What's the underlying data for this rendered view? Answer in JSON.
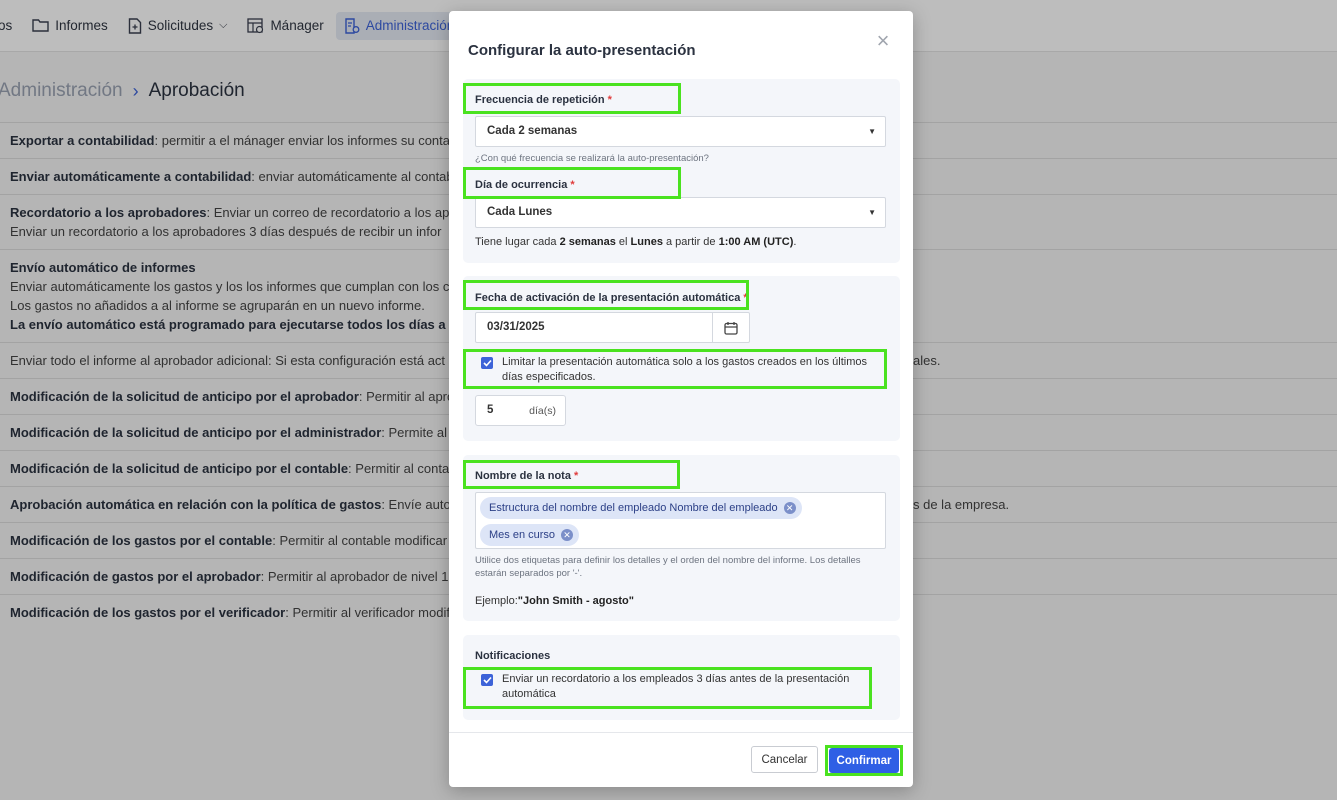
{
  "nav": {
    "items": [
      "os",
      "Informes",
      "Solicitudes",
      "Mánager",
      "Administración"
    ]
  },
  "breadcrumb": {
    "parent": "Administración",
    "current": "Aprobación"
  },
  "settings": [
    {
      "title": "Exportar a contabilidad",
      "lines": [
        ": permitir a el mánager enviar los informes su conta"
      ]
    },
    {
      "title": "Enviar automáticamente a contabilidad",
      "lines": [
        ": enviar automáticamente al contab"
      ]
    },
    {
      "title": "Recordatorio a los aprobadores",
      "lines": [
        ": Enviar un correo de recordatorio a los apr",
        "Enviar un recordatorio a los aprobadores 3 días después de recibir un infor"
      ]
    },
    {
      "title": "Envío automático de informes",
      "lines": [
        "",
        "Enviar automáticamente los gastos y los los informes que cumplan con los c",
        "Los gastos no añadidos a al informe se agruparán en un nuevo informe."
      ],
      "bold_line": "La envío automático está programado para ejecutarse todos los días a las"
    },
    {
      "title": "",
      "lines": [
        "Enviar todo el informe al aprobador adicional: Si esta configuración está act",
        "ales."
      ]
    },
    {
      "title": "Modificación de la solicitud de anticipo por el aprobador",
      "lines": [
        ": Permitir al aprob"
      ]
    },
    {
      "title": "Modificación de la solicitud de anticipo por el administrador",
      "lines": [
        ": Permite al ac"
      ]
    },
    {
      "title": "Modificación de la solicitud de anticipo por el contable",
      "lines": [
        ": Permitir al contabl"
      ]
    },
    {
      "title": "Aprobación automática en relación con la política de gastos",
      "lines": [
        ": Envíe autom",
        "s de la empresa."
      ]
    },
    {
      "title": "Modificación de los gastos por el contable",
      "lines": [
        ": Permitir al contable modificar lo"
      ]
    },
    {
      "title": "Modificación de gastos por el aprobador",
      "lines": [
        ": Permitir al aprobador de nivel 1 m"
      ]
    },
    {
      "title": "Modificación de los gastos por el verificador",
      "lines": [
        ": Permitir al verificador modific"
      ]
    }
  ],
  "modal": {
    "title": "Configurar la auto-presentación",
    "close_icon": "×",
    "frequency": {
      "label": "Frecuencia de repetición",
      "value": "Cada 2 semanas",
      "hint": "¿Con qué frecuencia se realizará la auto-presentación?"
    },
    "day": {
      "label": "Día de ocurrencia",
      "value": "Cada Lunes"
    },
    "summary": {
      "prefix": "Tiene lugar cada ",
      "freq": "2 semanas",
      "mid": " el ",
      "day": "Lunes",
      "mid2": " a partir de ",
      "time": "1:00 AM (UTC)",
      "suffix": "."
    },
    "activation": {
      "label": "Fecha de activación de la presentación automática",
      "date": "03/31/2025",
      "limit_checkbox": "Limitar la presentación automática solo a los gastos creados en los últimos días especificados.",
      "limit_checked": true,
      "days_value": "5",
      "days_unit": "día(s)"
    },
    "note": {
      "label": "Nombre de la nota",
      "tags": [
        "Estructura del nombre del empleado Nombre del empleado",
        "Mes en curso"
      ],
      "hint": "Utilice dos etiquetas para definir los detalles y el orden del nombre del informe. Los detalles estarán separados por '-'.",
      "example_label": "Ejemplo:",
      "example_value": "\"John Smith - agosto\""
    },
    "notifications": {
      "label": "Notificaciones",
      "checkbox": "Enviar un recordatorio a los empleados 3 días antes de la presentación automática",
      "checked": true
    },
    "buttons": {
      "cancel": "Cancelar",
      "confirm": "Confirmar"
    }
  },
  "colors": {
    "accent": "#3d63d8",
    "confirm": "#2f5fe5",
    "highlight": "#4ae21f",
    "required": "#e03b3b"
  }
}
